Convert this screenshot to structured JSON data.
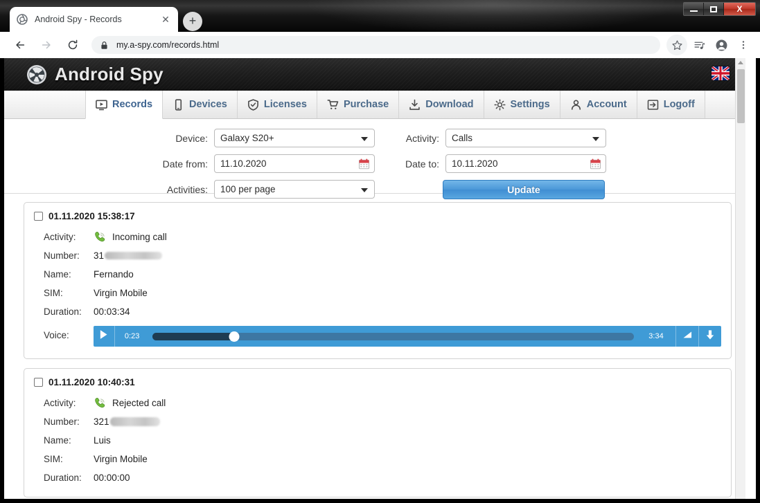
{
  "window": {
    "minimize_label": "Minimize",
    "maximize_label": "Maximize",
    "close_label": "X"
  },
  "browser": {
    "tab": {
      "title": "Android Spy - Records",
      "favicon_icon": "aperture-icon",
      "close_label": "✕"
    },
    "new_tab_label": "+",
    "back_label": "←",
    "forward_label": "→",
    "reload_label": "↻",
    "url": "my.a-spy.com/records.html",
    "lock_icon": "lock-icon",
    "right_icons": [
      "star-icon",
      "media-list-icon",
      "profile-icon",
      "kebab-menu-icon"
    ]
  },
  "site": {
    "brand": "Android Spy",
    "logo_icon": "aperture-logo-icon",
    "language_flag": "uk-flag-icon",
    "nav": [
      {
        "label": "Records",
        "icon": "records-icon",
        "active": true
      },
      {
        "label": "Devices",
        "icon": "phone-icon",
        "active": false
      },
      {
        "label": "Licenses",
        "icon": "shield-check-icon",
        "active": false
      },
      {
        "label": "Purchase",
        "icon": "cart-icon",
        "active": false
      },
      {
        "label": "Download",
        "icon": "download-icon",
        "active": false
      },
      {
        "label": "Settings",
        "icon": "gear-icon",
        "active": false
      },
      {
        "label": "Account",
        "icon": "user-icon",
        "active": false
      },
      {
        "label": "Logoff",
        "icon": "logout-icon",
        "active": false
      }
    ]
  },
  "filters": {
    "device_label": "Device:",
    "device_value": "Galaxy S20+",
    "activity_label": "Activity:",
    "activity_value": "Calls",
    "date_from_label": "Date from:",
    "date_from_value": "11.10.2020",
    "date_to_label": "Date to:",
    "date_to_value": "10.11.2020",
    "activities_label": "Activities:",
    "activities_value": "100 per page",
    "update_label": "Update",
    "calendar_icon": "calendar-icon"
  },
  "records": [
    {
      "timestamp": "01.11.2020 15:38:17",
      "activity_label": "Activity:",
      "activity_value": "Incoming call",
      "activity_icon": "incoming-call-icon",
      "number_label": "Number:",
      "number_value": "31",
      "number_redacted": true,
      "name_label": "Name:",
      "name_value": "Fernando",
      "sim_label": "SIM:",
      "sim_value": "Virgin Mobile",
      "duration_label": "Duration:",
      "duration_value": "00:03:34",
      "voice_label": "Voice:",
      "player": {
        "play_icon": "play-icon",
        "current_time": "0:23",
        "total_time": "3:34",
        "progress_percent": 17,
        "volume_icon": "volume-icon",
        "download_icon": "download-arrow-icon"
      }
    },
    {
      "timestamp": "01.11.2020 10:40:31",
      "activity_label": "Activity:",
      "activity_value": "Rejected call",
      "activity_icon": "rejected-call-icon",
      "number_label": "Number:",
      "number_value": "321",
      "number_redacted": true,
      "name_label": "Name:",
      "name_value": "Luis",
      "sim_label": "SIM:",
      "sim_value": "Virgin Mobile",
      "duration_label": "Duration:",
      "duration_value": "00:00:00"
    }
  ],
  "colors": {
    "accent_blue": "#3f9bd6",
    "nav_text": "#4b6a8a",
    "header_dark": "#1e1e1e",
    "calendar_red": "#d8434a",
    "call_green": "#73bd3f"
  }
}
